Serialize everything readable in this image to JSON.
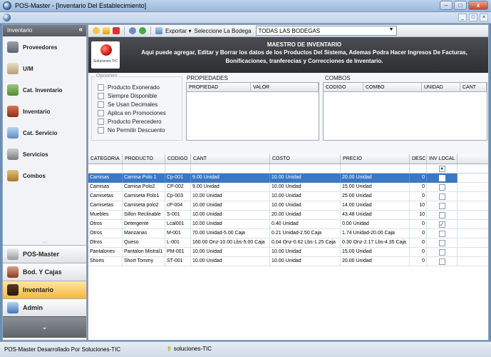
{
  "window": {
    "title": "POS-Master - [Inventario Del Establecimiento]",
    "min_label": "–",
    "max_label": "□",
    "close_label": "x"
  },
  "mdi": {
    "min_label": "_",
    "max_label": "□",
    "close_label": "×"
  },
  "sidebar": {
    "header": "Inventario",
    "collapse_icon": "«",
    "splitter": "....",
    "items": [
      {
        "label": "Proveedores",
        "icon": "truck-icon"
      },
      {
        "label": "U/M",
        "icon": "scale-icon"
      },
      {
        "label": "Cat. Inventario",
        "icon": "category-icon"
      },
      {
        "label": "Inventario",
        "icon": "books-icon"
      },
      {
        "label": "Cat. Servicio",
        "icon": "service-category-icon"
      },
      {
        "label": "Servicios",
        "icon": "tools-icon"
      },
      {
        "label": "Combos",
        "icon": "combo-box-icon"
      }
    ],
    "big_items": [
      {
        "label": "POS-Master",
        "icon": "pos-icon",
        "active": false
      },
      {
        "label": "Bod. Y Cajas",
        "icon": "warehouse-icon",
        "active": false
      },
      {
        "label": "Inventario",
        "icon": "inventory-icon",
        "active": true
      },
      {
        "label": "Admin",
        "icon": "admin-icon",
        "active": false
      }
    ],
    "chevron": "⌄"
  },
  "toolbar": {
    "export_label": "Exportar",
    "export_arrow": "▾",
    "bodega_label": "Seleccione La Bodega",
    "bodega_value": "TODAS LAS BODEGAS",
    "dropdown_arrow": "▼"
  },
  "banner": {
    "logo_text": "Soluciones-TIC",
    "title": "MAESTRO DE INVENTARIO",
    "description": "Aqui puede agregar, Editar y Borrar los datos de los Productos Del Sistema, Ademas Podra Hacer Ingresos De Facturas, Bonificaciones, tranferecias y Correcciones de Inventario."
  },
  "opciones": {
    "title": "Opciones",
    "checkboxes": [
      "Producto Exonerado",
      "Siempre Disponible",
      "Se Usan Decimales",
      "Aplica en Promociones",
      "Producto Perecedero",
      "No Permitir Descuento"
    ]
  },
  "propiedades": {
    "title": "PROPIEDADES",
    "columns": [
      "PROPIEDAD",
      "VALOR"
    ]
  },
  "combos": {
    "title": "COMBOS",
    "columns": [
      "CODIGO",
      "COMBO",
      "UNIDAD",
      "CANT"
    ]
  },
  "grid": {
    "columns": [
      "CATEGORIA",
      "PRODUCTO",
      "CODIGO",
      "CANT",
      "COSTO",
      "PRECIO",
      "DESC",
      "INV LOCAL"
    ],
    "filter_check": "■",
    "rows": [
      {
        "categoria": "Camisas",
        "producto": "Camisa Polo 1",
        "codigo": "Cp-001",
        "cant": "9.00 Unidad",
        "costo": "10.00 Unidad",
        "precio": "20.00 Unidad",
        "desc": "0",
        "inv": false,
        "selected": true
      },
      {
        "categoria": "Camisas",
        "producto": "Camisa Polo2",
        "codigo": "CP-002",
        "cant": "9.00 Unidad",
        "costo": "10.00 Unidad",
        "precio": "15.00 Unidad",
        "desc": "0",
        "inv": false,
        "selected": false
      },
      {
        "categoria": "Camisetas",
        "producto": "Camiseta Polo1",
        "codigo": "Cp-003",
        "cant": "10.00 Unidad",
        "costo": "10.00 Unidad",
        "precio": "25.00 Unidad",
        "desc": "0",
        "inv": false,
        "selected": false
      },
      {
        "categoria": "Camisetas",
        "producto": "Camiseta polo2",
        "codigo": "cP-004",
        "cant": "10.00 Unidad",
        "costo": "10.00 Unidad",
        "precio": "14.00 Unidad",
        "desc": "10",
        "inv": false,
        "selected": false
      },
      {
        "categoria": "Muebles",
        "producto": "Sillon Reclinable",
        "codigo": "S-001",
        "cant": "10.00 Unidad",
        "costo": "20.00 Unidad",
        "precio": "43.48 Unidad",
        "desc": "10",
        "inv": false,
        "selected": false
      },
      {
        "categoria": "Otros",
        "producto": "Detergente",
        "codigo": "Lcal001",
        "cant": "10.00 Unidad",
        "costo": "0.40 Unidad",
        "precio": "0.00 Unidad",
        "desc": "0",
        "inv": true,
        "selected": false
      },
      {
        "categoria": "Otros",
        "producto": "Manzanas",
        "codigo": "M-001",
        "cant": "70.00 Unidad-5.00 Caja",
        "costo": "0.21 Unidad-2.50 Caja",
        "precio": "1.74 Unidad-20.00 Caja",
        "desc": "0",
        "inv": false,
        "selected": false
      },
      {
        "categoria": "Otros",
        "producto": "Queso",
        "codigo": "L-001",
        "cant": "160.00 Onz-10.00 Lbs-5.00 Caja",
        "costo": "0.04 Onz-0.62 Lbs-1.25 Caja",
        "precio": "0.30 Onz-2.17 Lbs-4.35 Caja",
        "desc": "0",
        "inv": false,
        "selected": false
      },
      {
        "categoria": "Pantalones",
        "producto": "Pantalon Mistral1",
        "codigo": "PM-001",
        "cant": "10.00 Unidad",
        "costo": "10.00 Unidad",
        "precio": "15.00 Unidad",
        "desc": "0",
        "inv": false,
        "selected": false
      },
      {
        "categoria": "Shorts",
        "producto": "Short Tommy",
        "codigo": "ST-001",
        "cant": "10.00 Unidad",
        "costo": "10.00 Unidad",
        "precio": "20.00 Unidad",
        "desc": "0",
        "inv": false,
        "selected": false
      }
    ]
  },
  "statusbar": {
    "text": "POS-Master Desarrollado Por Soluciones-TIC",
    "link": "soluciones-TIC"
  },
  "colors": {
    "selection": "#3a78c4",
    "banner": "#2c2e31",
    "active_nav": "#f6b83c"
  }
}
